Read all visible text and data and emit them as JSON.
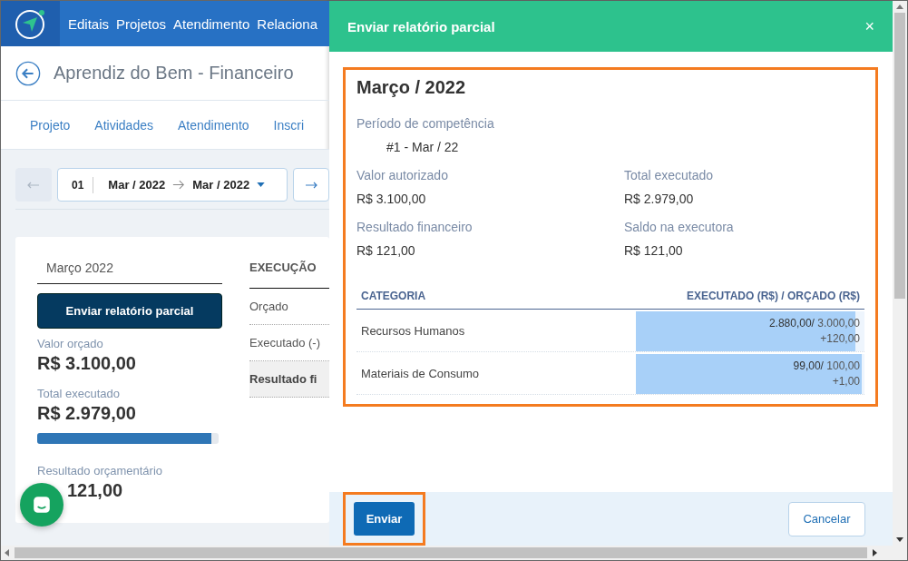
{
  "navbar": {
    "items": [
      "Editais",
      "Projetos",
      "Atendimento",
      "Relaciona"
    ]
  },
  "page": {
    "title": "Aprendiz do Bem - Financeiro"
  },
  "tabs": [
    "Projeto",
    "Atividades",
    "Atendimento",
    "Inscri"
  ],
  "period_selector": {
    "number": "01",
    "start": "Mar / 2022",
    "end": "Mar / 2022"
  },
  "summary_card": {
    "month": "Março 2022",
    "button": "Enviar relatório parcial",
    "stats": [
      {
        "label": "Valor orçado",
        "value": "R$ 3.100,00"
      },
      {
        "label": "Total executado",
        "value": "R$ 2.979,00",
        "level": 0.96
      },
      {
        "label": "Resultado orçamentário",
        "value": "121,00",
        "partly_covered": true
      }
    ]
  },
  "execution_table": {
    "heading": "EXECUÇÃO",
    "rows": [
      {
        "label": "Orçado",
        "kind": "line"
      },
      {
        "label": "Executado (-)",
        "kind": "line"
      },
      {
        "label": "Resultado fi",
        "kind": "total"
      }
    ]
  },
  "dialog": {
    "title": "Enviar relatório parcial",
    "close": "×",
    "heading": "Março / 2022",
    "period": {
      "label": "Período de competência",
      "value": "#1 - Mar / 22"
    },
    "fields": [
      {
        "label": "Valor autorizado",
        "value": "R$ 3.100,00"
      },
      {
        "label": "Total executado",
        "value": "R$ 2.979,00"
      },
      {
        "label": "Resultado financeiro",
        "value": "R$ 121,00"
      },
      {
        "label": "Saldo na executora",
        "value": "R$ 121,00"
      }
    ],
    "table": {
      "columns": [
        "CATEGORIA",
        "EXECUTADO (R$) / ORÇADO (R$)"
      ],
      "rows": [
        {
          "category": "Recursos Humanos",
          "amount": "**2.880,00/** 3.000,00",
          "difference": "+120,00",
          "level": 0.96
        },
        {
          "category": "Materiais de Consumo",
          "amount": "**99,00/** 100,00",
          "difference": "+1,00",
          "level": 0.99
        }
      ]
    },
    "buttons": {
      "submit": "Enviar",
      "cancel": "Cancelar"
    }
  }
}
